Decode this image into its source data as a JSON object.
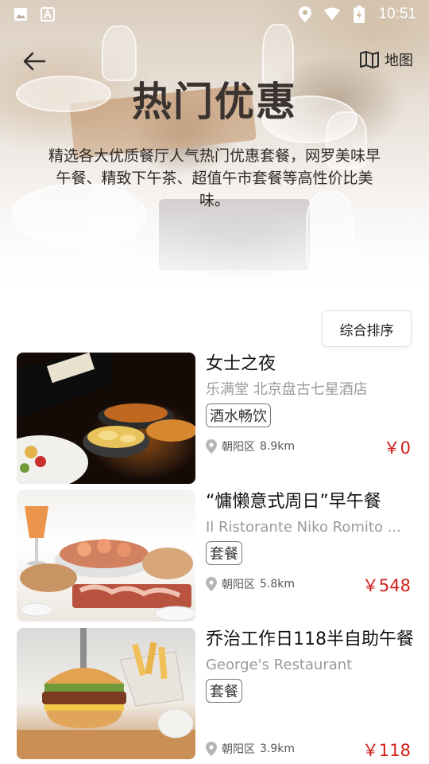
{
  "status_bar": {
    "time": "10:51",
    "icons": [
      "image-icon",
      "font-icon",
      "location-icon",
      "wifi-icon",
      "battery-icon"
    ]
  },
  "nav": {
    "map_label": "地图"
  },
  "hero": {
    "title": "热门优惠",
    "description": "精选各大优质餐厅人气热门优惠套餐，网罗美味早午餐、精致下午茶、超值午市套餐等高性价比美味。"
  },
  "sort": {
    "label": "综合排序"
  },
  "deals": [
    {
      "title": "女士之夜",
      "restaurant": "乐满堂 北京盘古七星酒店",
      "tag": "酒水畅饮",
      "district": "朝阳区",
      "distance": "8.9km",
      "price": "￥0"
    },
    {
      "title": "“慵懒意式周日”早午餐",
      "restaurant": "Il Ristorante Niko Romito ...",
      "tag": "套餐",
      "district": "朝阳区",
      "distance": "5.8km",
      "price": "￥548"
    },
    {
      "title": "乔治工作日118半自助午餐",
      "restaurant": "George's Restaurant",
      "tag": "套餐",
      "district": "朝阳区",
      "distance": "3.9km",
      "price": "￥118"
    }
  ],
  "colors": {
    "price": "#d0201b",
    "subtle_text": "#9a9a9a"
  }
}
